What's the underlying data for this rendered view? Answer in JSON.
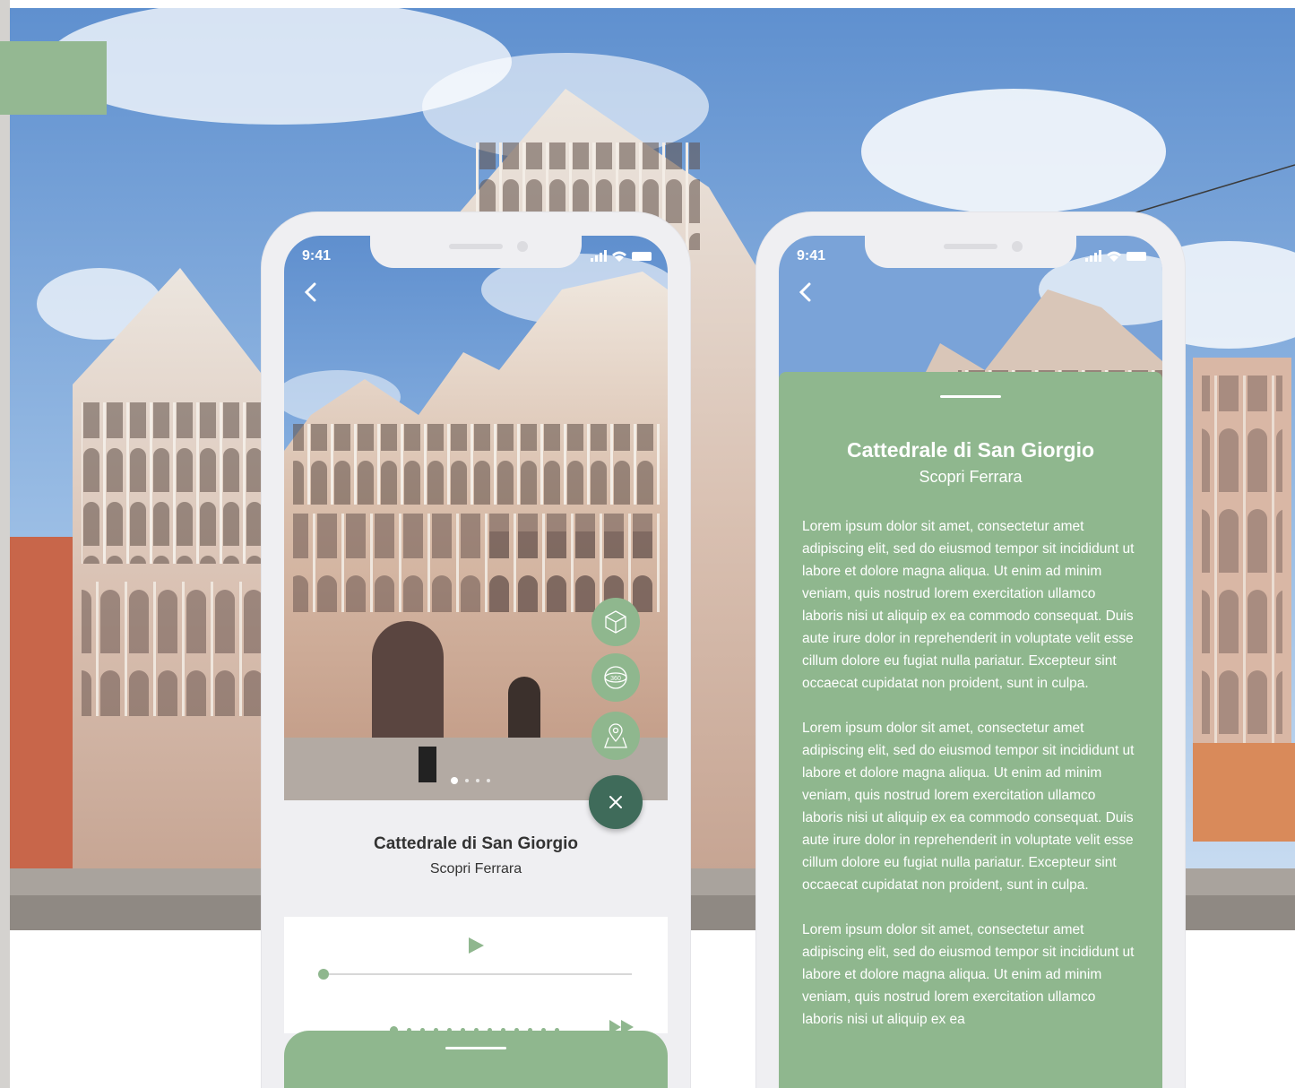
{
  "background": {
    "sky": "#6e9cd4",
    "accent": "#94b892"
  },
  "colors": {
    "green": "#8fb78e",
    "dark_green": "#3f6b5a",
    "frame": "#efeff2",
    "text": "#333333"
  },
  "phone1": {
    "status": {
      "time": "9:41",
      "icons": [
        "signal-icon",
        "wifi-icon",
        "battery-icon"
      ]
    },
    "back_icon": "chevron-left-icon",
    "fabs": [
      "ar-cube-icon",
      "360-view-icon",
      "map-pin-icon"
    ],
    "close_icon": "close-icon",
    "slides": 4,
    "active_slide": 1,
    "title": "Cattedrale di San Giorgio",
    "subtitle": "Scopri Ferrara",
    "player": {
      "play_icon": "play-icon",
      "ffwd_icon": "fast-forward-icon",
      "progress": 0,
      "chapters": 13,
      "active_chapter": 1
    }
  },
  "phone2": {
    "status": {
      "time": "9:41"
    },
    "back_icon": "chevron-left-icon",
    "title": "Cattedrale di San Giorgio",
    "subtitle": "Scopri Ferrara",
    "paragraphs": [
      "Lorem ipsum dolor sit amet, consectetur amet adipiscing elit, sed do eiusmod tempor  sit incididunt ut labore et dolore magna aliqua. Ut enim ad minim veniam, quis nostrud lorem exercitation ullamco laboris nisi ut aliquip ex ea commodo consequat. Duis aute irure dolor in reprehenderit in voluptate velit esse  cillum dolore eu fugiat nulla pariatur.  Excepteur sint occaecat cupidatat non  proident, sunt in culpa.",
      "Lorem ipsum dolor sit amet, consectetur amet adipiscing elit, sed do eiusmod tempor  sit incididunt ut labore et dolore magna aliqua. Ut enim ad minim veniam, quis nostrud lorem exercitation ullamco laboris nisi ut aliquip ex ea commodo consequat. Duis aute irure dolor in reprehenderit in voluptate velit esse  cillum dolore eu fugiat nulla pariatur.  Excepteur sint occaecat cupidatat non  proident, sunt in culpa.",
      "Lorem ipsum dolor sit amet, consectetur amet adipiscing elit, sed do eiusmod tempor  sit incididunt ut labore et dolore magna aliqua. Ut enim ad minim veniam, quis nostrud lorem exercitation ullamco laboris nisi ut aliquip ex ea"
    ]
  }
}
